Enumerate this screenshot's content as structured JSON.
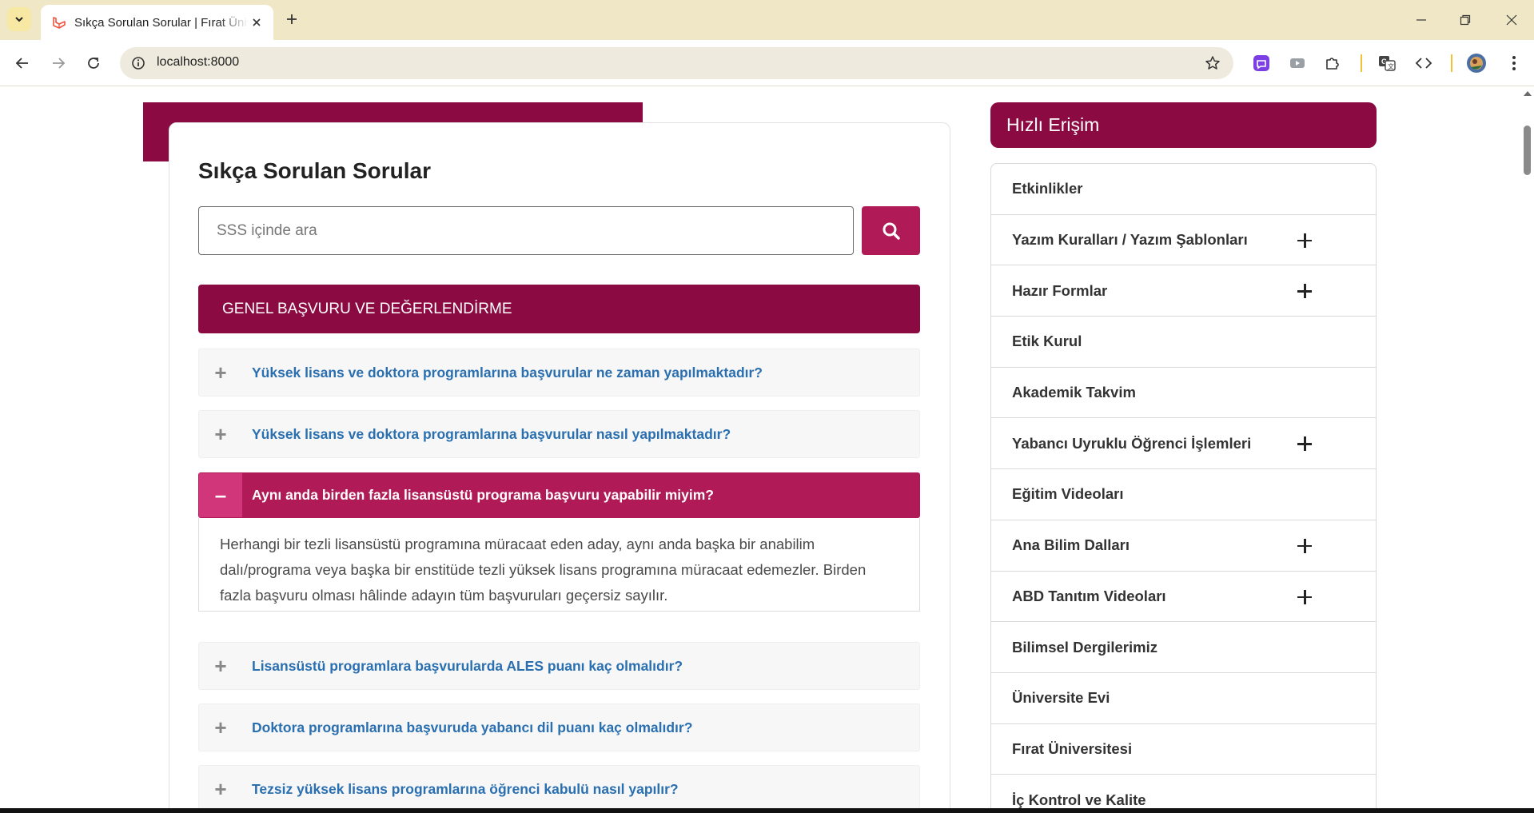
{
  "browser": {
    "tab_title": "Sıkça Sorulan Sorular | Fırat Üniversitesi",
    "url": "localhost:8000",
    "icons": {
      "tab_search": "chevron-down-icon",
      "favicon": "laravel-icon",
      "tab_close": "close-icon",
      "new_tab": "plus-icon",
      "back": "arrow-left-icon",
      "forward": "arrow-right-icon",
      "reload": "reload-icon",
      "site_info": "info-icon",
      "bookmark": "star-icon",
      "extensions": "puzzle-icon",
      "translate": "translate-icon",
      "devtools": "code-icon",
      "profile": "avatar-icon"
    }
  },
  "faq": {
    "title": "Sıkça Sorulan Sorular",
    "search_placeholder": "SSS içinde ara",
    "search_icon": "search-icon",
    "category": "GENEL BAŞVURU VE DEĞERLENDİRME",
    "questions": [
      {
        "q": "Yüksek lisans ve doktora programlarına başvurular ne zaman yapılmaktadır?",
        "toggle": "+",
        "open": false
      },
      {
        "q": "Yüksek lisans ve doktora programlarına başvurular nasıl yapılmaktadır?",
        "toggle": "+",
        "open": false
      },
      {
        "q": "Aynı anda birden fazla lisansüstü programa başvuru yapabilir miyim?",
        "toggle": "–",
        "open": true,
        "answer": "Herhangi bir tezli lisansüstü programına müracaat eden aday, aynı anda başka bir anabilim dalı/programa veya başka bir enstitüde tezli yüksek lisans programına müracaat edemezler. Birden fazla başvuru olması hâlinde adayın tüm başvuruları geçersiz sayılır."
      },
      {
        "q": "Lisansüstü programlara başvurularda ALES puanı kaç olmalıdır?",
        "toggle": "+",
        "open": false
      },
      {
        "q": "Doktora programlarına başvuruda yabancı dil puanı kaç olmalıdır?",
        "toggle": "+",
        "open": false
      },
      {
        "q": "Tezsiz yüksek lisans programlarına öğrenci kabulü nasıl yapılır?",
        "toggle": "+",
        "open": false
      }
    ]
  },
  "sidebar": {
    "title": "Hızlı Erişim",
    "items": [
      {
        "label": "Etkinlikler",
        "expandable": false
      },
      {
        "label": "Yazım Kuralları / Yazım Şablonları",
        "expandable": true
      },
      {
        "label": "Hazır Formlar",
        "expandable": true
      },
      {
        "label": "Etik Kurul",
        "expandable": false
      },
      {
        "label": "Akademik Takvim",
        "expandable": false
      },
      {
        "label": "Yabancı Uyruklu Öğrenci İşlemleri",
        "expandable": true
      },
      {
        "label": "Eğitim Videoları",
        "expandable": false
      },
      {
        "label": "Ana Bilim Dalları",
        "expandable": true
      },
      {
        "label": "ABD Tanıtım Videoları",
        "expandable": true
      },
      {
        "label": "Bilimsel Dergilerimiz",
        "expandable": false
      },
      {
        "label": "Üniversite Evi",
        "expandable": false
      },
      {
        "label": "Fırat Üniversitesi",
        "expandable": false
      },
      {
        "label": "İç Kontrol ve Kalite",
        "expandable": false
      }
    ]
  },
  "colors": {
    "brand_maroon": "#8c0a42",
    "accent_pink": "#b01a56",
    "question_link": "#2a6fb0"
  }
}
